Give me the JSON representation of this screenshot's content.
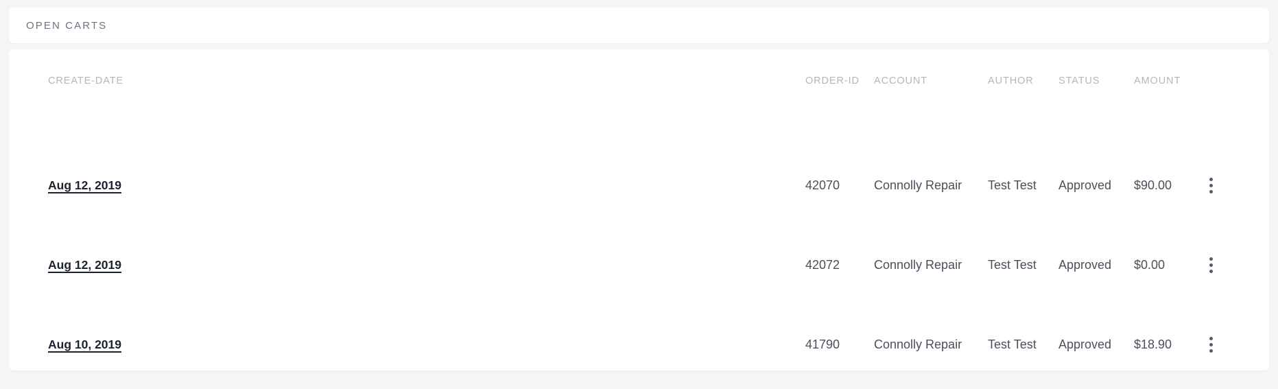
{
  "panel": {
    "title": "OPEN CARTS"
  },
  "table": {
    "columns": [
      {
        "key": "create_date",
        "label": "CREATE-DATE"
      },
      {
        "key": "order_id",
        "label": "ORDER-ID"
      },
      {
        "key": "account",
        "label": "ACCOUNT"
      },
      {
        "key": "author",
        "label": "AUTHOR"
      },
      {
        "key": "status",
        "label": "STATUS"
      },
      {
        "key": "amount",
        "label": "AMOUNT"
      }
    ],
    "rows": [
      {
        "create_date": "Aug 12, 2019",
        "order_id": "42070",
        "account": "Connolly Repair",
        "author": "Test Test",
        "status": "Approved",
        "amount": "$90.00",
        "menu_icon": "overflow-menu-vertical-icon"
      },
      {
        "create_date": "Aug 12, 2019",
        "order_id": "42072",
        "account": "Connolly Repair",
        "author": "Test Test",
        "status": "Approved",
        "amount": "$0.00",
        "menu_icon": "overflow-menu-vertical-icon"
      },
      {
        "create_date": "Aug 10, 2019",
        "order_id": "41790",
        "account": "Connolly Repair",
        "author": "Test Test",
        "status": "Approved",
        "amount": "$18.90",
        "menu_icon": "overflow-menu-vertical-icon"
      }
    ]
  },
  "colors": {
    "page_background": "#f4f5f6",
    "card_background": "#ffffff",
    "panel_title": "#6b7280",
    "column_header": "#b3b6bd",
    "cell_text": "#4a4f5c",
    "link_text": "#1c2230",
    "menu_dot": "#565a6e"
  }
}
